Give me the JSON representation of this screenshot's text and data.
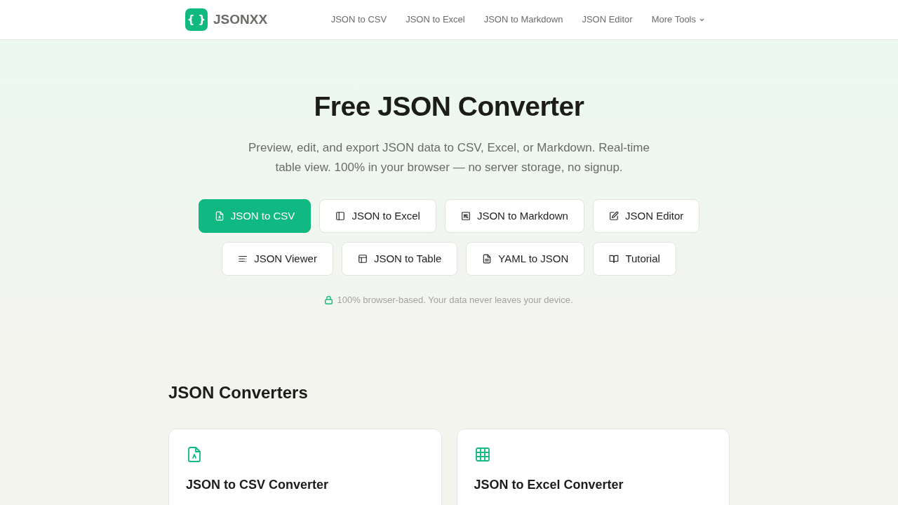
{
  "header": {
    "logo": {
      "mark": "{ }",
      "name": "JSONXX"
    },
    "nav": [
      {
        "label": "JSON to CSV",
        "kind": "link"
      },
      {
        "label": "JSON to Excel",
        "kind": "link"
      },
      {
        "label": "JSON to Markdown",
        "kind": "link"
      },
      {
        "label": "JSON Editor",
        "kind": "link"
      },
      {
        "label": "More Tools",
        "kind": "dropdown"
      }
    ]
  },
  "hero": {
    "title": "Free JSON Converter",
    "subtitle": "Preview, edit, and export JSON data to CSV, Excel, or Markdown. Real-time table view. 100% in your browser — no server storage, no signup.",
    "tool_rows": [
      [
        {
          "label": "JSON to CSV",
          "kind": "csv",
          "selected": true
        },
        {
          "label": "JSON to Excel",
          "kind": "excel",
          "selected": false
        },
        {
          "label": "JSON to Markdown",
          "kind": "markdown",
          "selected": false
        },
        {
          "label": "JSON Editor",
          "kind": "editor",
          "selected": false
        }
      ],
      [
        {
          "label": "JSON Viewer",
          "kind": "viewer",
          "selected": false
        },
        {
          "label": "JSON to Table",
          "kind": "table",
          "selected": false
        },
        {
          "label": "YAML to JSON",
          "kind": "yaml",
          "selected": false
        },
        {
          "label": "Tutorial",
          "kind": "tutorial",
          "selected": false
        }
      ]
    ],
    "note": "100% browser-based. Your data never leaves your device."
  },
  "section": {
    "title": "JSON Converters",
    "cards": [
      {
        "kind": "csv",
        "title": "JSON to CSV Converter"
      },
      {
        "kind": "grid",
        "title": "JSON to Excel Converter"
      }
    ]
  }
}
